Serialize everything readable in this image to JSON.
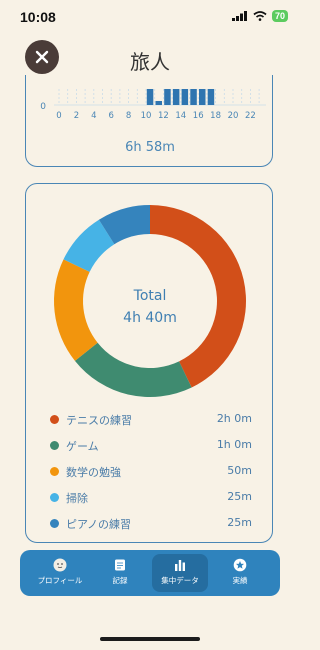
{
  "status_bar": {
    "time": "10:08",
    "battery": "70"
  },
  "header": {
    "title": "旅人"
  },
  "hourly_chart": {
    "y_label": "0",
    "x_ticks": [
      "0",
      "2",
      "4",
      "6",
      "8",
      "10",
      "12",
      "14",
      "16",
      "18",
      "20",
      "22"
    ],
    "duration": "6h 58m"
  },
  "chart_data": {
    "type": "pie",
    "center_title": "Total",
    "center_value": "4h 40m",
    "slices": [
      {
        "label": "テニスの練習",
        "value_text": "2h 0m",
        "minutes": 120,
        "color": "#d24f19"
      },
      {
        "label": "ゲーム",
        "value_text": "1h 0m",
        "minutes": 60,
        "color": "#3f8b70"
      },
      {
        "label": "数学の勉強",
        "value_text": "50m",
        "minutes": 50,
        "color": "#f2950d"
      },
      {
        "label": "掃除",
        "value_text": "25m",
        "minutes": 25,
        "color": "#46b3e6"
      },
      {
        "label": "ピアノの練習",
        "value_text": "25m",
        "minutes": 25,
        "color": "#3584bd"
      }
    ]
  },
  "tabs": [
    {
      "label": "プロフィール",
      "icon": "profile-icon"
    },
    {
      "label": "記録",
      "icon": "record-icon"
    },
    {
      "label": "集中データ",
      "icon": "bar-chart-icon",
      "active": true
    },
    {
      "label": "実績",
      "icon": "achievement-icon"
    }
  ],
  "colors": {
    "accent": "#2f83bd",
    "background": "#f8f2e6"
  }
}
